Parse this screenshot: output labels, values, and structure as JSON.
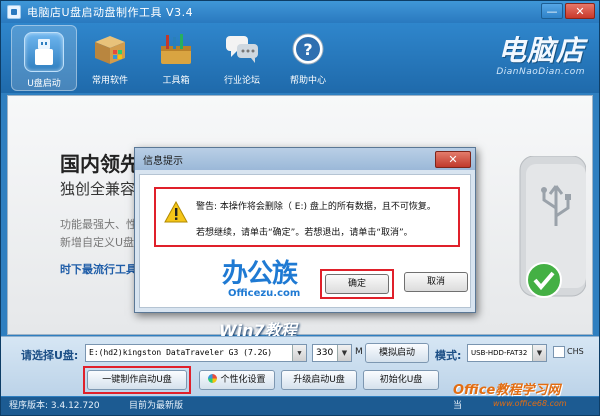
{
  "window": {
    "title": "电脑店U盘启动盘制作工具 V3.4",
    "min_label": "—",
    "close_label": "✕"
  },
  "toolbar": {
    "items": [
      {
        "label": "U盘启动",
        "icon": "usb-icon"
      },
      {
        "label": "常用软件",
        "icon": "software-box-icon"
      },
      {
        "label": "工具箱",
        "icon": "toolbox-icon"
      },
      {
        "label": "行业论坛",
        "icon": "forum-chat-icon"
      },
      {
        "label": "帮助中心",
        "icon": "help-icon"
      }
    ],
    "brand_name": "电脑店",
    "brand_domain": "DianNaoDian.com"
  },
  "banner": {
    "title": "国内领先",
    "subtitle": "独创全兼容",
    "feature_1": "功能最强大、性",
    "feature_2": "新增自定义U盘",
    "link": "时下最流行工具"
  },
  "dialog": {
    "title": "信息提示",
    "close_label": "✕",
    "message_1": "警告: 本操作将会删除（ E:) 盘上的所有数据，且不可恢复。",
    "message_2": "若想继续，请单击“确定”。若想退出，请单击“取消”。",
    "ok_label": "确定",
    "cancel_label": "取消"
  },
  "watermarks": {
    "logo_text": "办公族",
    "logo_sub": "Officezu.com",
    "win7": "Win7教程",
    "site": "Office教程学习网",
    "site_url": "www.office68.com"
  },
  "controls": {
    "select_label": "请选择U盘:",
    "device_value": "E:(hd2)kingston DataTraveler G3 (7.2G)",
    "size_value": "330",
    "size_unit": "M",
    "simulate_label": "模拟启动",
    "mode_label": "模式:",
    "mode_value": "USB-HDD-FAT32",
    "chs_label": "CHS",
    "start_label": "一键制作启动U盘",
    "personal_label": "个性化设置",
    "upgrade_label": "升级启动U盘",
    "init_label": "初始化U盘"
  },
  "status": {
    "version": "程序版本: 3.4.12.720",
    "state": "目前为最新版",
    "right": "当"
  },
  "colors": {
    "titlebar": "#2a79bf",
    "toolbar": "#1f6aab",
    "highlight": "#e0202a",
    "link": "#1e5da8"
  }
}
